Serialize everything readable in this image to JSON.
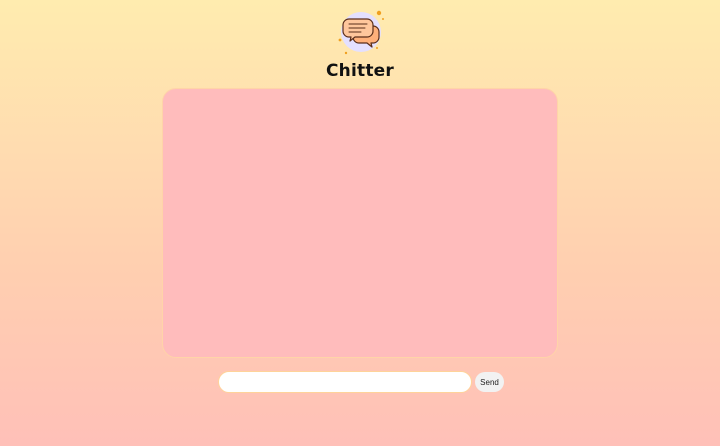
{
  "app": {
    "title": "Chitter"
  },
  "logo": {
    "icon": "chat-bubbles-icon",
    "colors": {
      "circle": "#e4e0ff",
      "bubble_fill": "#ffc69c",
      "bubble_stroke": "#5a2e1a",
      "sparkle": "#f0a020"
    }
  },
  "chat": {
    "messages": []
  },
  "composer": {
    "input_value": "",
    "input_placeholder": "",
    "send_label": "Send"
  },
  "colors": {
    "background_top": "#ffecaf",
    "background_bottom": "#ffc0b8",
    "chat_area": "#ffbcbc",
    "chat_border": "#ffd4a8",
    "input_border": "#ffd39a",
    "send_button": "#f2f2f2"
  }
}
